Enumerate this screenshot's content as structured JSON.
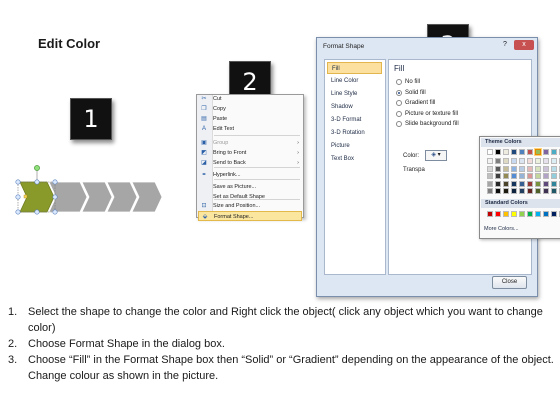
{
  "slide": {
    "title": "Edit Color",
    "steps": [
      "1",
      "2",
      "3"
    ]
  },
  "context_menu": {
    "items": [
      {
        "icon": "cut-icon",
        "glyph": "✂",
        "label": "Cut",
        "arrow": "",
        "disabled": false,
        "highlighted": false
      },
      {
        "icon": "copy-icon",
        "glyph": "❐",
        "label": "Copy",
        "arrow": "",
        "disabled": false,
        "highlighted": false
      },
      {
        "icon": "paste-icon",
        "glyph": "▤",
        "label": "Paste",
        "arrow": "",
        "disabled": false,
        "highlighted": false
      },
      {
        "icon": "edit-text-icon",
        "glyph": "A",
        "label": "Edit Text",
        "arrow": "",
        "disabled": false,
        "highlighted": false
      },
      {
        "icon": "group-icon",
        "glyph": "▣",
        "label": "Group",
        "arrow": "›",
        "disabled": true,
        "highlighted": false
      },
      {
        "icon": "bring-to-front-icon",
        "glyph": "◩",
        "label": "Bring to Front",
        "arrow": "›",
        "disabled": false,
        "highlighted": false
      },
      {
        "icon": "send-to-back-icon",
        "glyph": "◪",
        "label": "Send to Back",
        "arrow": "›",
        "disabled": false,
        "highlighted": false
      },
      {
        "icon": "hyperlink-icon",
        "glyph": "⚭",
        "label": "Hyperlink...",
        "arrow": "",
        "disabled": false,
        "highlighted": false
      },
      {
        "icon": "save-as-picture-icon",
        "glyph": "",
        "label": "Save as Picture...",
        "arrow": "",
        "disabled": false,
        "highlighted": false
      },
      {
        "icon": "set-default-shape-icon",
        "glyph": "",
        "label": "Set as Default Shape",
        "arrow": "",
        "disabled": false,
        "highlighted": false
      },
      {
        "icon": "size-position-icon",
        "glyph": "⊡",
        "label": "Size and Position...",
        "arrow": "",
        "disabled": false,
        "highlighted": false
      },
      {
        "icon": "format-shape-icon",
        "glyph": "⬙",
        "label": "Format Shape...",
        "arrow": "",
        "disabled": false,
        "highlighted": true
      }
    ]
  },
  "dialog": {
    "title": "Format Shape",
    "help": "?",
    "close_x": "x",
    "nav": [
      "Fill",
      "Line Color",
      "Line Style",
      "Shadow",
      "3-D Format",
      "3-D Rotation",
      "Picture",
      "Text Box"
    ],
    "selected_nav": "Fill",
    "panel_title": "Fill",
    "options": [
      {
        "label": "No fill",
        "checked": false
      },
      {
        "label": "Solid fill",
        "checked": true
      },
      {
        "label": "Gradient fill",
        "checked": false
      },
      {
        "label": "Picture or texture fill",
        "checked": false
      },
      {
        "label": "Slide background fill",
        "checked": false
      }
    ],
    "color_label": "Color:",
    "transparency_label": "Transpa",
    "spin_value": "÷",
    "palette": {
      "theme_header": "Theme Colors",
      "standard_header": "Standard Colors",
      "more": "More Colors...",
      "theme_top": [
        "#ffffff",
        "#000000",
        "#eeece1",
        "#1f497d",
        "#4f81bd",
        "#c0504d",
        "#9bbb59",
        "#8064a2",
        "#4bacc6",
        "#f79646"
      ],
      "theme_shades": [
        [
          "#f2f2f2",
          "#7f7f7f",
          "#ddd9c3",
          "#c6d9f0",
          "#dbe5f1",
          "#f2dcdb",
          "#ebf1dd",
          "#e5e0ec",
          "#dbeef3",
          "#fdeada"
        ],
        [
          "#d8d8d8",
          "#595959",
          "#c4bd97",
          "#8db3e2",
          "#b8cce4",
          "#e5b9b7",
          "#d7e3bc",
          "#ccc1d9",
          "#b7dde8",
          "#fbd5b5"
        ],
        [
          "#bfbfbf",
          "#3f3f3f",
          "#938953",
          "#548dd4",
          "#95b3d7",
          "#d99694",
          "#c3d69b",
          "#b2a2c7",
          "#92cddc",
          "#fac08f"
        ],
        [
          "#a5a5a5",
          "#262626",
          "#494429",
          "#17365d",
          "#366092",
          "#953734",
          "#76923c",
          "#5f497a",
          "#31859b",
          "#e36c09"
        ],
        [
          "#7f7f7f",
          "#0c0c0c",
          "#1d1b10",
          "#0f243e",
          "#244061",
          "#632423",
          "#4f6128",
          "#3f3151",
          "#205867",
          "#974806"
        ]
      ],
      "standard": [
        "#c00000",
        "#ff0000",
        "#ffc000",
        "#ffff00",
        "#92d050",
        "#00b050",
        "#00b0f0",
        "#0070c0",
        "#002060",
        "#7030a0"
      ],
      "selected_swatch": "#9bbb59"
    },
    "close_button": "Close"
  },
  "shape": {
    "first_chevron_color": "#8a9a2a",
    "chevron_color": "#a6a6a6"
  },
  "instructions": [
    {
      "n": "1.",
      "text": "Select the shape to change the color and Right click the object( click any object which you want to change color)"
    },
    {
      "n": "2.",
      "text": "Choose Format Shape in the dialog box."
    },
    {
      "n": "3.",
      "text": "Choose “Fill” in the Format Shape box then “Solid” or “Gradient” depending on the appearance of the object. Change colour as shown in the picture."
    }
  ]
}
